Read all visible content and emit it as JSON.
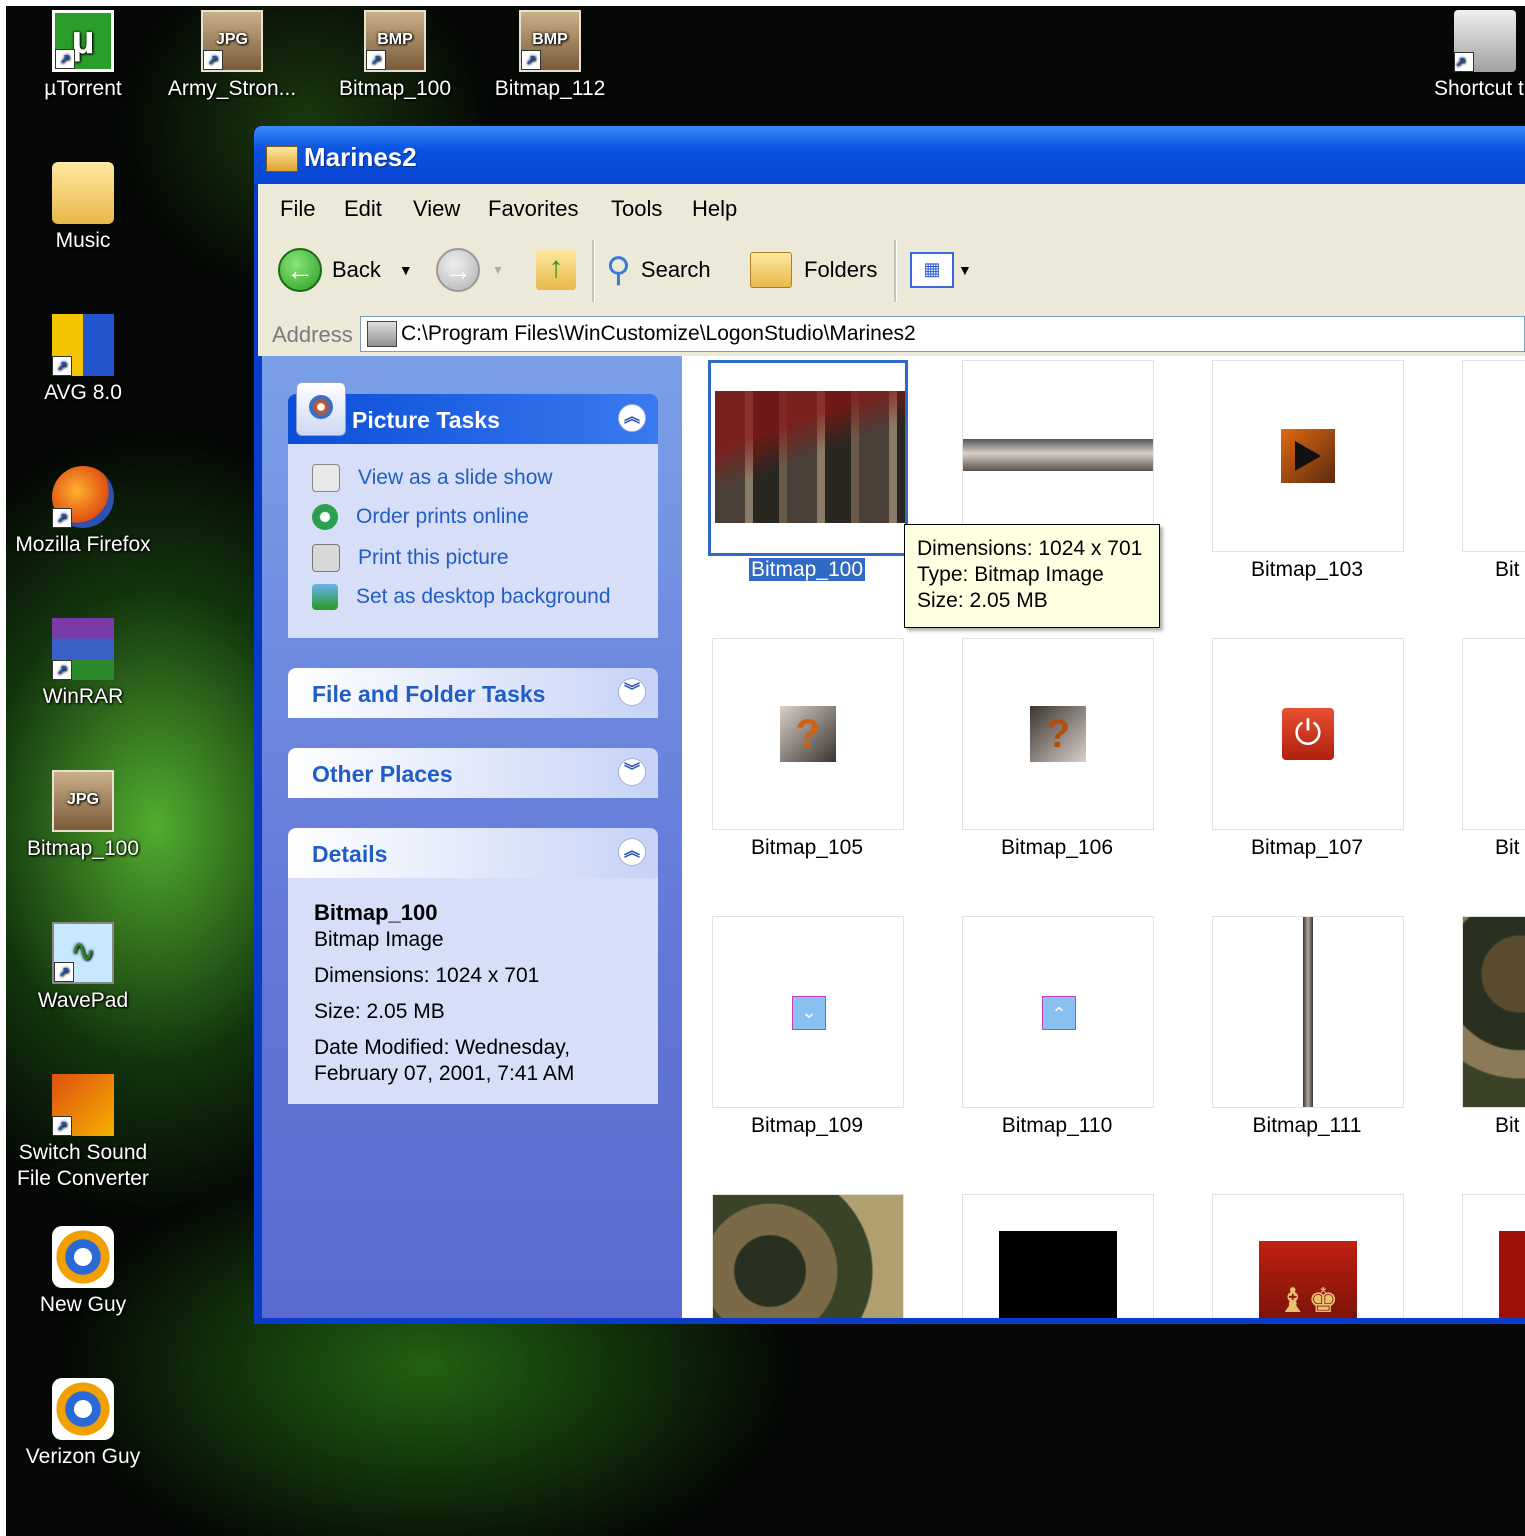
{
  "desktop": {
    "top_icons": [
      {
        "label": "µTorrent"
      },
      {
        "label": "Army_Stron..."
      },
      {
        "label": "Bitmap_100"
      },
      {
        "label": "Bitmap_112"
      },
      {
        "label": "Shortcut t"
      }
    ],
    "file_badges": {
      "jpg": "JPG",
      "bmp": "BMP"
    },
    "left_icons": [
      {
        "label": "Music"
      },
      {
        "label": "AVG 8.0"
      },
      {
        "label": "Mozilla Firefox"
      },
      {
        "label": "WinRAR"
      },
      {
        "label": "Bitmap_100"
      },
      {
        "label": "WavePad"
      },
      {
        "label": "Switch Sound File Converter"
      },
      {
        "label": "New Guy"
      },
      {
        "label": "Verizon Guy"
      }
    ]
  },
  "window": {
    "title": "Marines2",
    "menu": [
      "File",
      "Edit",
      "View",
      "Favorites",
      "Tools",
      "Help"
    ],
    "toolbar": {
      "back": "Back",
      "search": "Search",
      "folders": "Folders"
    },
    "address": {
      "label": "Address",
      "path": "C:\\Program Files\\WinCustomize\\LogonStudio\\Marines2"
    },
    "panels": {
      "picture_tasks": {
        "title": "Picture Tasks",
        "tasks": [
          "View as a slide show",
          "Order prints online",
          "Print this picture",
          "Set as desktop background"
        ]
      },
      "file_folder_tasks": {
        "title": "File and Folder Tasks"
      },
      "other_places": {
        "title": "Other Places"
      },
      "details": {
        "title": "Details",
        "name": "Bitmap_100",
        "type": "Bitmap Image",
        "dimensions": "Dimensions: 1024 x 701",
        "size": "Size: 2.05 MB",
        "date1": "Date Modified: Wednesday,",
        "date2": "February 07, 2001, 7:41 AM"
      }
    },
    "thumbnails": [
      {
        "label": "Bitmap_100"
      },
      {
        "label": "Bitmap_103"
      },
      {
        "label": "Bit"
      },
      {
        "label": "Bitmap_105"
      },
      {
        "label": "Bitmap_106"
      },
      {
        "label": "Bitmap_107"
      },
      {
        "label": "Bit"
      },
      {
        "label": "Bitmap_109"
      },
      {
        "label": "Bitmap_110"
      },
      {
        "label": "Bitmap_111"
      },
      {
        "label": "Bit"
      }
    ],
    "tooltip": {
      "dimensions": "Dimensions: 1024 x 701",
      "type": "Type: Bitmap Image",
      "size": "Size: 2.05 MB"
    }
  },
  "colors": {
    "selection": "#316ac5",
    "titlebar": "#0a52e0",
    "task_link": "#215dc6"
  }
}
